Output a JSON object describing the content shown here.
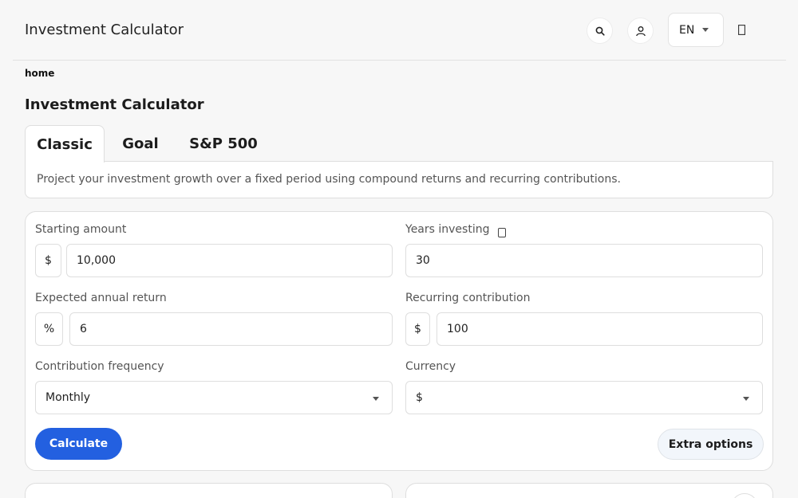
{
  "header": {
    "title": "Investment Calculator",
    "language": "EN"
  },
  "breadcrumb": "home",
  "page_title": "Investment Calculator",
  "tabs": [
    {
      "label": "Classic",
      "active": true
    },
    {
      "label": "Goal",
      "active": false
    },
    {
      "label": "S&P 500",
      "active": false
    }
  ],
  "tab_description": "Project your investment growth over a fixed period using compound returns and recurring contributions.",
  "form": {
    "starting_amount": {
      "label": "Starting amount",
      "prefix": "$",
      "value": "10,000"
    },
    "years_investing": {
      "label": "Years investing",
      "value": "30"
    },
    "annual_return": {
      "label": "Expected annual return",
      "prefix": "%",
      "value": "6"
    },
    "recurring_contribution": {
      "label": "Recurring contribution",
      "prefix": "$",
      "value": "100"
    },
    "contribution_frequency": {
      "label": "Contribution frequency",
      "value": "Monthly"
    },
    "currency": {
      "label": "Currency",
      "value": "$"
    }
  },
  "buttons": {
    "calculate": "Calculate",
    "extra_options": "Extra options"
  },
  "colors": {
    "accent": "#2360e0",
    "background": "#f7f7f7"
  },
  "icons": {
    "search": "search-icon",
    "user": "user-icon",
    "theme": "theme-toggle-icon",
    "info": "info-icon"
  }
}
